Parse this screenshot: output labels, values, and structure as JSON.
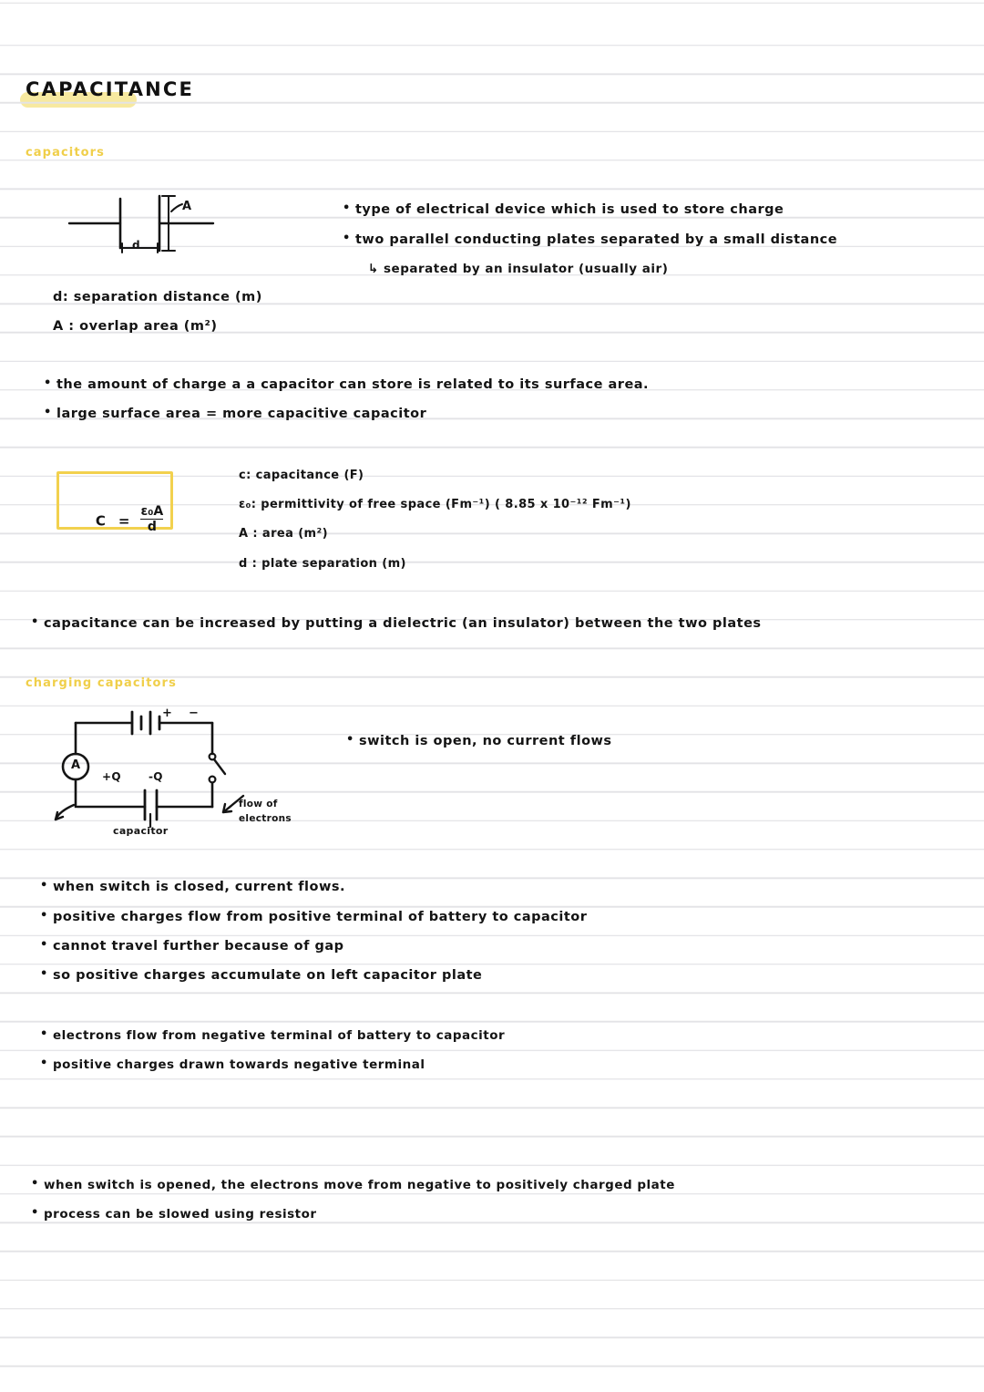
{
  "page": {
    "title": "CAPACITANCE",
    "paper": "ruled-notebook",
    "colors": {
      "ink": "#141414",
      "highlight": "#f7e9a0",
      "heading_yellow": "#f0cf4a",
      "box_border": "#f2d14e",
      "rule_line": "#e3e3e6"
    }
  },
  "sections": [
    {
      "heading": "capacitors",
      "diagram": {
        "name": "parallel-plate-capacitor",
        "labels": {
          "area": "A",
          "separation": "d"
        }
      },
      "bullets": [
        "type of electrical device which is used to store charge",
        "two parallel conducting plates separated by a small distance"
      ],
      "subbullets": [
        "↳ separated by an insulator (usually air)"
      ],
      "definitions": [
        "d: separation distance (m)",
        "A : overlap area (m²)"
      ],
      "bullets2": [
        "the amount of charge a a capacitor can store is related to its surface area.",
        "large surface area = more capacitive capacitor"
      ],
      "formula": {
        "lhs": "C",
        "equals": "=",
        "numerator": "ε₀A",
        "denominator": "d"
      },
      "formula_key": [
        "c: capacitance (F)",
        "ε₀: permittivity of free space (Fm⁻¹) ( 8.85 x 10⁻¹² Fm⁻¹)",
        "A : area (m²)",
        "d : plate separation (m)"
      ],
      "bullets3": [
        "capacitance can be increased by putting a dielectric (an insulator) between the two plates"
      ]
    },
    {
      "heading": "charging capacitors",
      "circuit": {
        "name": "charging-capacitor-circuit",
        "labels": {
          "battery_positive": "+",
          "battery_negative": "−",
          "ammeter": "A",
          "plate_positive": "+Q",
          "plate_negative": "-Q",
          "component": "capacitor",
          "flow_line1": "flow of",
          "flow_line2": "electrons"
        }
      },
      "bullets": [
        "switch is open, no current flows"
      ],
      "bullets2": [
        "when switch is closed, current flows.",
        "positive charges flow from positive terminal of battery to capacitor",
        "cannot travel further because of gap",
        "so positive charges accumulate on left capacitor plate"
      ],
      "bullets3": [
        "electrons flow from negative terminal of battery to capacitor",
        "positive charges drawn towards negative terminal"
      ],
      "bullets4": [
        "when switch is opened, the electrons move from negative to positively charged plate",
        "process can be slowed using resistor"
      ]
    }
  ]
}
